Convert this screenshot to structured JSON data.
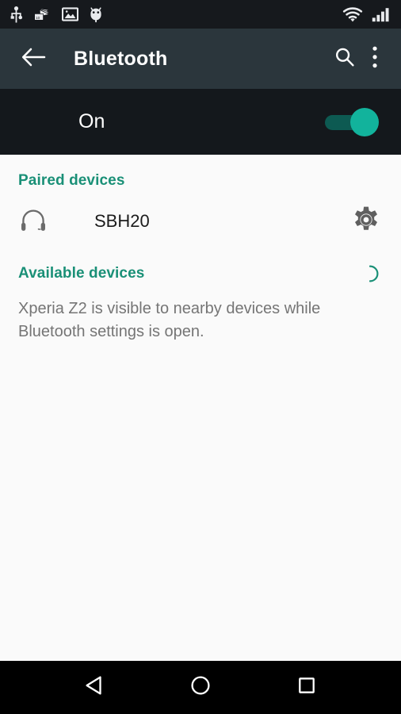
{
  "status_bar": {
    "left_icons": [
      {
        "name": "usb-icon",
        "label": "USB connected"
      },
      {
        "name": "cards-fan-icon",
        "label": "Cards"
      },
      {
        "name": "photo-icon",
        "label": "Screenshot captured"
      },
      {
        "name": "android-mascot-icon",
        "label": "Android"
      }
    ],
    "right_icons": [
      {
        "name": "wifi-icon",
        "label": "Wi-Fi"
      },
      {
        "name": "cellular-signal-icon",
        "label": "Cellular signal"
      }
    ],
    "background_color": "#16191d"
  },
  "app_bar": {
    "title": "Bluetooth",
    "back_icon": "arrow-back-icon",
    "search_icon": "search-icon",
    "overflow_icon": "more-vert-icon",
    "background_color": "#2b363c",
    "title_color": "#ffffff"
  },
  "bluetooth_toggle": {
    "state_label": "On",
    "checked": true,
    "track_color": "#0d5a52",
    "thumb_color": "#12b39c",
    "background_color": "#14181c"
  },
  "paired_section": {
    "header": "Paired devices",
    "devices": [
      {
        "name": "SBH20",
        "icon": "headset-icon",
        "settings_icon": "gear-icon"
      }
    ]
  },
  "available_section": {
    "header": "Available devices",
    "scanning": true,
    "spinner_icon": "loading-spinner-icon",
    "visibility_note": "Xperia Z2 is visible to nearby devices while Bluetooth settings is open."
  },
  "theme": {
    "accent_color": "#1a9077",
    "content_background": "#fafafa",
    "primary_text": "#1c1c1c",
    "secondary_text": "#757575",
    "icon_gray": "#6b6b6b"
  },
  "nav_bar": {
    "buttons": [
      {
        "name": "nav-back-button",
        "icon": "triangle-back-icon",
        "label": "Back"
      },
      {
        "name": "nav-home-button",
        "icon": "circle-home-icon",
        "label": "Home"
      },
      {
        "name": "nav-recents-button",
        "icon": "square-recents-icon",
        "label": "Recents"
      }
    ],
    "background_color": "#000000"
  }
}
